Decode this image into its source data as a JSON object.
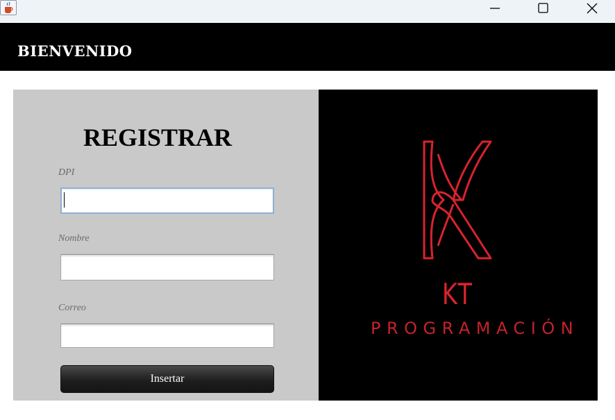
{
  "window": {
    "icon": "java-cup-icon",
    "controls": [
      "minimize-icon",
      "maximize-icon",
      "close-icon"
    ]
  },
  "header": {
    "title": "BIENVENIDO"
  },
  "form": {
    "title": "REGISTRAR",
    "fields": [
      {
        "label": "DPI",
        "value": ""
      },
      {
        "label": "Nombre",
        "value": ""
      },
      {
        "label": "Correo",
        "value": ""
      }
    ],
    "submit_label": "Insertar"
  },
  "logo": {
    "letters": "KT",
    "tagline": "PROGRAMACIÓN",
    "color": "#d9232d"
  },
  "colors": {
    "header_bg": "#000000",
    "form_bg": "#c9c9c9",
    "accent": "#d9232d"
  }
}
